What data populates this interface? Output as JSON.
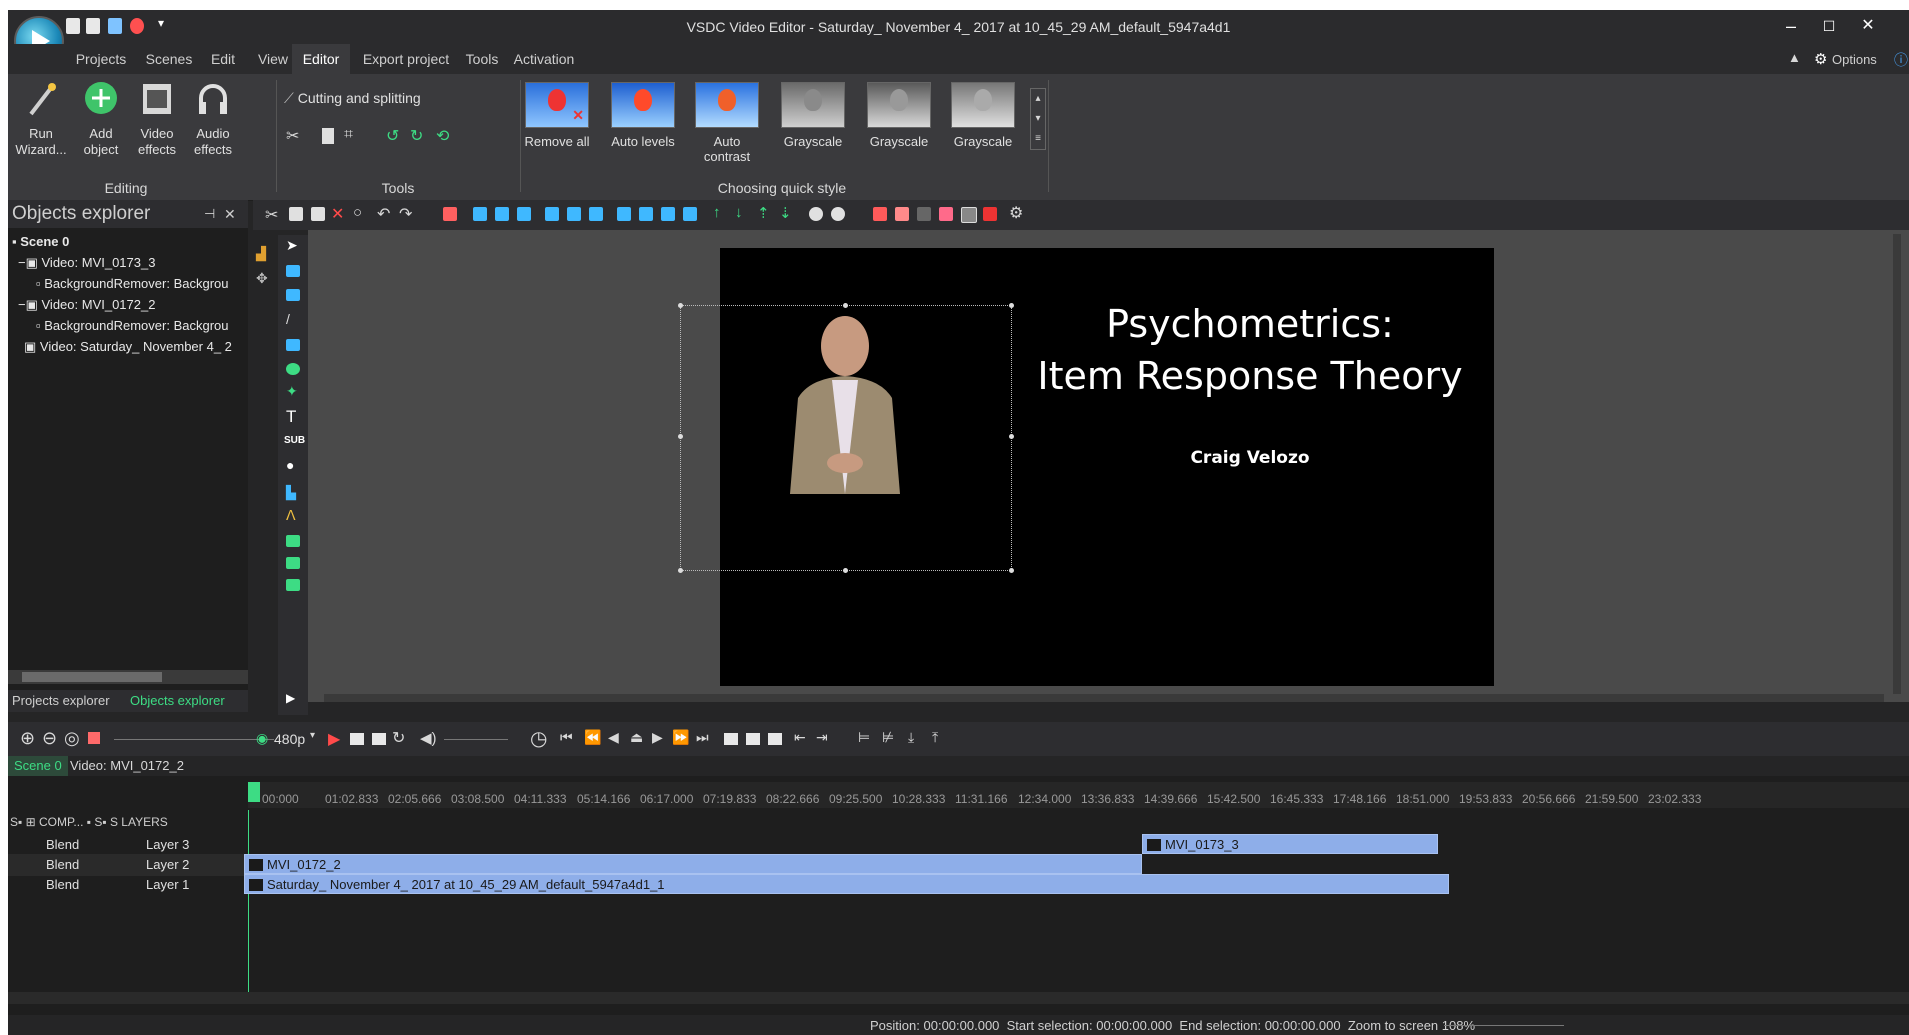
{
  "window": {
    "title": "VSDC Video Editor - Saturday_ November 4_ 2017 at 10_45_29 AM_default_5947a4d1",
    "minimize": "–",
    "maximize": "☐",
    "close": "✕",
    "options_label": "Options"
  },
  "menu": {
    "tabs": [
      "Projects",
      "Scenes",
      "Edit",
      "View",
      "Editor",
      "Export project",
      "Tools",
      "Activation"
    ],
    "active": "Editor"
  },
  "ribbon": {
    "editing": {
      "run_wizard": "Run Wizard...",
      "add_object": "Add object",
      "video_effects": "Video effects",
      "audio_effects": "Audio effects",
      "group_label": "Editing"
    },
    "tools": {
      "cutting_label": "Cutting and splitting",
      "group_label": "Tools"
    },
    "quick_style": {
      "items": [
        "Remove all",
        "Auto levels",
        "Auto contrast",
        "Grayscale",
        "Grayscale",
        "Grayscale"
      ],
      "group_label": "Choosing quick style"
    }
  },
  "objects_explorer": {
    "title": "Objects explorer",
    "pin": "ᵽ",
    "close": "✕",
    "tree": [
      "Scene 0",
      "Video: MVI_0173_3",
      "BackgroundRemover: Backgrou",
      "Video: MVI_0172_2",
      "BackgroundRemover: Backgrou",
      "Video: Saturday_ November 4_ 2"
    ],
    "bottom_tabs": [
      "Projects explorer",
      "Objects explorer"
    ]
  },
  "slide": {
    "title_line1": "Psychometrics:",
    "title_line2": "Item Response Theory",
    "author": "Craig Velozo"
  },
  "playback": {
    "resolution": "480p"
  },
  "timeline_tabs": [
    "Scene 0",
    "Video: MVI_0172_2"
  ],
  "timeline": {
    "header_cols": "S▪  ⊞ COMP... ▪  S▪  S LAYERS",
    "ticks": [
      "00:000",
      "01:02.833",
      "02:05.666",
      "03:08.500",
      "04:11.333",
      "05:14.166",
      "06:17.000",
      "07:19.833",
      "08:22.666",
      "09:25.500",
      "10:28.333",
      "11:31.166",
      "12:34.000",
      "13:36.833",
      "14:39.666",
      "15:42.500",
      "16:45.333",
      "17:48.166",
      "18:51.000",
      "19:53.833",
      "20:56.666",
      "21:59.500",
      "23:02.333"
    ],
    "layers": [
      {
        "blend": "Blend",
        "name": "Layer 3"
      },
      {
        "blend": "Blend",
        "name": "Layer 2"
      },
      {
        "blend": "Blend",
        "name": "Layer 1"
      }
    ],
    "clips": {
      "layer3": "MVI_0173_3",
      "layer2": "MVI_0172_2",
      "layer1": "Saturday_ November 4_ 2017 at 10_45_29 AM_default_5947a4d1_1"
    }
  },
  "status": {
    "position_label": "Position:",
    "position_value": "00:00:00.000",
    "start_label": "Start selection:",
    "start_value": "00:00:00.000",
    "end_label": "End selection:",
    "end_value": "00:00:00.000",
    "zoom_label": "Zoom to screen",
    "zoom_value": "108%"
  },
  "colors": {
    "background": "#252526",
    "ribbon": "#3a3a3d",
    "clip": "#8eaee9",
    "accent_green": "#3ddc84",
    "accent_red": "#e83a3a"
  }
}
